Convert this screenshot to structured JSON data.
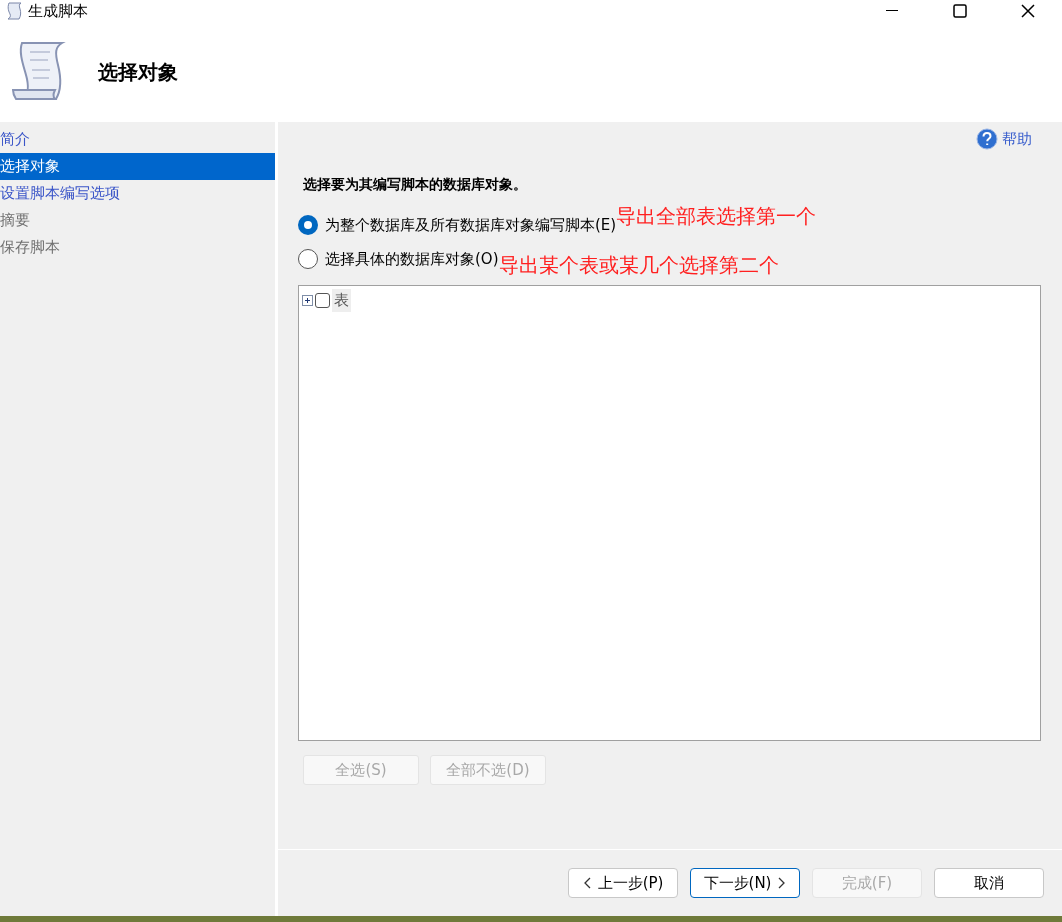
{
  "window": {
    "title": "生成脚本"
  },
  "header": {
    "title": "选择对象"
  },
  "sidebar": {
    "items": [
      {
        "label": "简介",
        "selected": false,
        "disabled": false
      },
      {
        "label": "选择对象",
        "selected": true,
        "disabled": false
      },
      {
        "label": "设置脚本编写选项",
        "selected": false,
        "disabled": false
      },
      {
        "label": "摘要",
        "selected": false,
        "disabled": true
      },
      {
        "label": "保存脚本",
        "selected": false,
        "disabled": true
      }
    ]
  },
  "help": "帮助",
  "instruction": "选择要为其编写脚本的数据库对象。",
  "options": [
    {
      "label": "为整个数据库及所有数据库对象编写脚本(E)",
      "selected": true,
      "note": "导出全部表选择第一个"
    },
    {
      "label": "选择具体的数据库对象(O)",
      "selected": false,
      "note": "导出某个表或某几个选择第二个"
    }
  ],
  "tree": [
    {
      "label": "表",
      "expanded": false,
      "checked": false
    }
  ],
  "tree_buttons": [
    {
      "label": "全选(S)",
      "disabled": true
    },
    {
      "label": "全部不选(D)",
      "disabled": true
    }
  ],
  "footer_buttons": [
    {
      "label": "上一步(P)",
      "kind": "back",
      "disabled": false,
      "focused": false
    },
    {
      "label": "下一步(N)",
      "kind": "next",
      "disabled": false,
      "focused": true
    },
    {
      "label": "完成(F)",
      "kind": "plain",
      "disabled": true,
      "focused": false
    },
    {
      "label": "取消",
      "kind": "plain",
      "disabled": false,
      "focused": false
    }
  ]
}
